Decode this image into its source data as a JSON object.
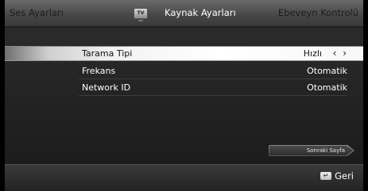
{
  "header": {
    "tab_left": "Ses Ayarları",
    "tab_center": "Kaynak Ayarları",
    "tab_right": "Ebeveyn Kontrolü",
    "tv_icon_text": "TV"
  },
  "settings": [
    {
      "label": "Tarama Tipi",
      "value": "Hızlı",
      "arrows": "‹ ›"
    },
    {
      "label": "Frekans",
      "value": "Otomatik"
    },
    {
      "label": "Network ID",
      "value": "Otomatik"
    }
  ],
  "next_page": {
    "label": "Sonraki Sayfa"
  },
  "footer": {
    "back_icon": "↵",
    "back_label": "Geri"
  },
  "colors": {
    "header_active_text": "#ffffff",
    "header_inactive_text": "#1c1c1c",
    "highlight": "#ffffff"
  }
}
